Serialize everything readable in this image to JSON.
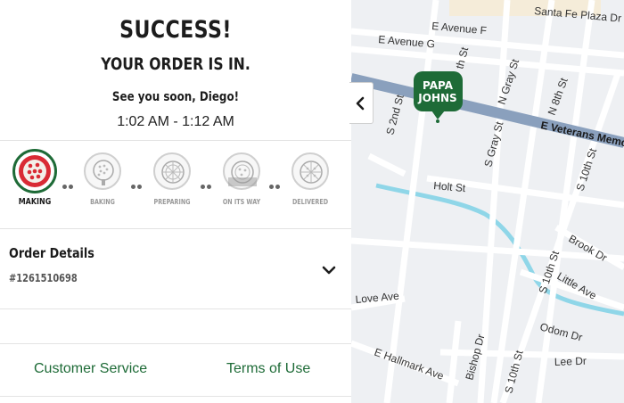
{
  "header": {
    "title": "SUCCESS!",
    "subtitle": "YOUR ORDER IS IN.",
    "greeting": "See you soon, Diego!",
    "time_window": "1:02 AM - 1:12 AM"
  },
  "tracker": {
    "current_step": "MAKING",
    "steps": [
      {
        "label": "MAKING",
        "icon": "pizza-making-icon",
        "active": true
      },
      {
        "label": "BAKING",
        "icon": "pizza-baking-icon",
        "active": false
      },
      {
        "label": "PREPARING",
        "icon": "pizza-preparing-icon",
        "active": false
      },
      {
        "label": "ON ITS WAY",
        "icon": "pizza-on-its-way-icon",
        "active": false
      },
      {
        "label": "DELIVERED",
        "icon": "pizza-delivered-icon",
        "active": false
      }
    ]
  },
  "order": {
    "title": "Order Details",
    "number": "#1261510698"
  },
  "footer": {
    "customer_service": "Customer Service",
    "terms": "Terms of Use"
  },
  "map": {
    "pin": {
      "line1": "PAPA",
      "line2": "JOHNS"
    },
    "streets": {
      "e_avenue_g": "E Avenue G",
      "e_avenue_f": "E Avenue F",
      "santa_fe": "Santa Fe Plaza Dr",
      "veterans": "E Veterans Memorial",
      "n_8th": "N 8th St",
      "n_gray": "N Gray St",
      "s_gray": "S Gray St",
      "s_2nd": "S 2nd St",
      "s_10th_a": "S 10th St",
      "s_10th_b": "S 10th St",
      "s_10th_c": "S 10th St",
      "holt": "Holt St",
      "brook": "Brook Dr",
      "little": "Little Ave",
      "odom": "Odom Dr",
      "lee": "Lee Dr",
      "love": "Love Ave",
      "hallmark": "E Hallmark Ave",
      "bishop": "Bishop Dr",
      "th_st": "th St"
    },
    "colors": {
      "road": "#ffffff",
      "major_road": "#8aa0bd",
      "water": "#8fd6e8",
      "land": "#eef0f3",
      "block": "#f5ecd9",
      "brand_green": "#1e6b37"
    }
  }
}
